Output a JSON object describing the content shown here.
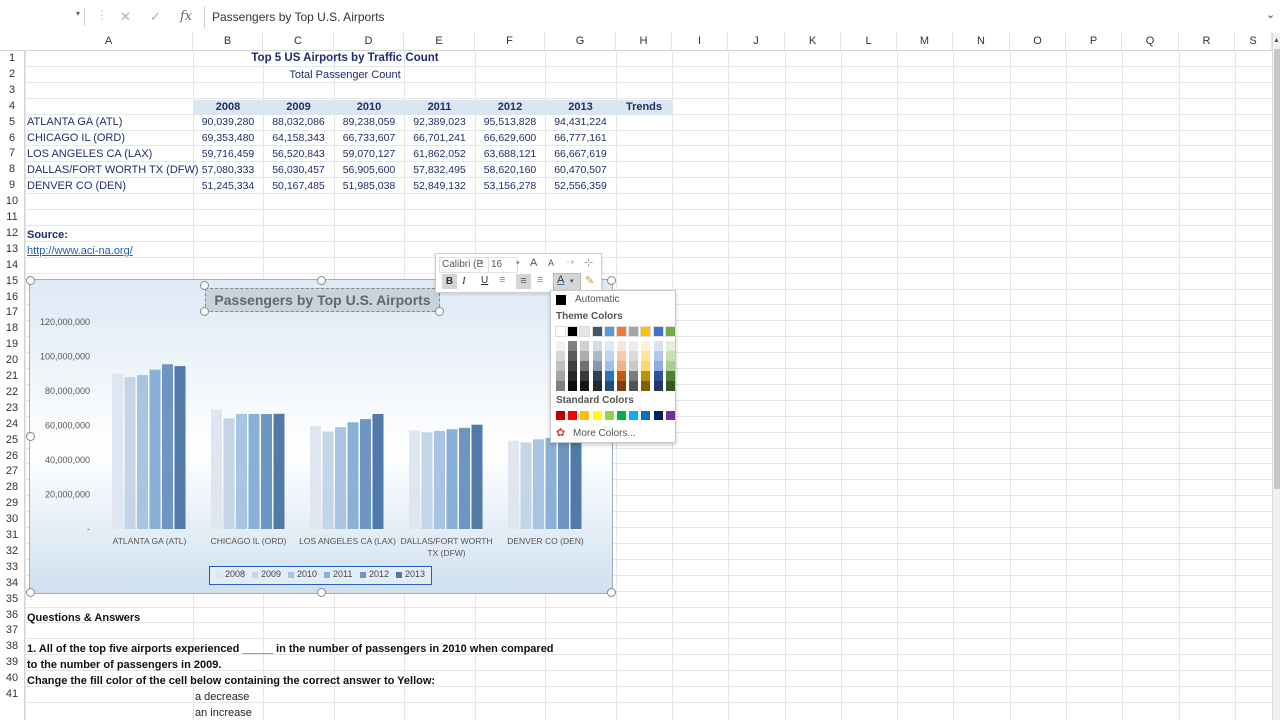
{
  "formula_bar": {
    "name_box": "",
    "cancel": "✕",
    "enter": "✓",
    "fx": "fx",
    "content": "Passengers by Top U.S. Airports"
  },
  "columns": [
    "A",
    "B",
    "C",
    "D",
    "E",
    "F",
    "G",
    "H",
    "I",
    "J",
    "K",
    "L",
    "M",
    "N",
    "O",
    "P",
    "Q",
    "R",
    "S"
  ],
  "rows": [
    "1",
    "2",
    "3",
    "4",
    "5",
    "6",
    "7",
    "8",
    "9",
    "10",
    "11",
    "12",
    "13",
    "14",
    "15",
    "16",
    "17",
    "18",
    "19",
    "20",
    "21",
    "22",
    "23",
    "24",
    "25",
    "26",
    "27",
    "28",
    "29",
    "30",
    "31",
    "32",
    "33",
    "34",
    "35",
    "36",
    "37",
    "38",
    "39",
    "40",
    "41"
  ],
  "sheet": {
    "title": "Top 5 US Airports by Traffic Count",
    "subtitle": "Total Passenger Count",
    "years": [
      "2008",
      "2009",
      "2010",
      "2011",
      "2012",
      "2013"
    ],
    "trends_label": "Trends",
    "airports": [
      {
        "name": "ATLANTA GA (ATL)",
        "values": [
          "90,039,280",
          "88,032,086",
          "89,238,059",
          "92,389,023",
          "95,513,828",
          "94,431,224"
        ]
      },
      {
        "name": "CHICAGO IL (ORD)",
        "values": [
          "69,353,480",
          "64,158,343",
          "66,733,607",
          "66,701,241",
          "66,629,600",
          "66,777,161"
        ]
      },
      {
        "name": "LOS ANGELES CA (LAX)",
        "values": [
          "59,716,459",
          "56,520,843",
          "59,070,127",
          "61,862,052",
          "63,688,121",
          "66,667,619"
        ]
      },
      {
        "name": "DALLAS/FORT WORTH TX (DFW)",
        "values": [
          "57,080,333",
          "56,030,457",
          "56,905,600",
          "57,832,495",
          "58,620,160",
          "60,470,507"
        ]
      },
      {
        "name": "DENVER CO (DEN)",
        "values": [
          "51,245,334",
          "50,167,485",
          "51,985,038",
          "52,849,132",
          "53,156,278",
          "52,556,359"
        ]
      }
    ],
    "source_label": "Source:",
    "source_link": "http://www.aci-na.org/",
    "qa_heading": "Questions & Answers",
    "question1_line1": "1. All of the top five airports experienced _____ in the number of passengers in 2010 when compared",
    "question1_line2": "to the number of passengers in 2009.",
    "instruction": "Change the fill color of the cell below containing the correct answer to Yellow:",
    "answer1": "a decrease",
    "answer2": "an increase"
  },
  "chart_data": {
    "type": "bar",
    "title": "Passengers by Top U.S. Airports",
    "categories": [
      "ATLANTA GA (ATL)",
      "CHICAGO IL (ORD)",
      "LOS ANGELES CA (LAX)",
      "DALLAS/FORT WORTH TX (DFW)",
      "DENVER CO (DEN)"
    ],
    "category_labels": [
      [
        "ATLANTA GA (ATL)"
      ],
      [
        "CHICAGO IL (ORD)"
      ],
      [
        "LOS ANGELES CA (LAX)"
      ],
      [
        "DALLAS/FORT WORTH",
        "TX (DFW)"
      ],
      [
        "DENVER CO (DEN)"
      ]
    ],
    "series": [
      {
        "name": "2008",
        "values": [
          90039280,
          69353480,
          59716459,
          57080333,
          51245334
        ],
        "color": "#dfe6ef"
      },
      {
        "name": "2009",
        "values": [
          88032086,
          64158343,
          56520843,
          56030457,
          50167485
        ],
        "color": "#c4d5e8"
      },
      {
        "name": "2010",
        "values": [
          89238059,
          66733607,
          59070127,
          56905600,
          51985038
        ],
        "color": "#a8c4e2"
      },
      {
        "name": "2011",
        "values": [
          92389023,
          66701241,
          61862052,
          57832495,
          52849132
        ],
        "color": "#8bb0d8"
      },
      {
        "name": "2012",
        "values": [
          95513828,
          66629600,
          63688121,
          58620160,
          53156278
        ],
        "color": "#6f95c2"
      },
      {
        "name": "2013",
        "values": [
          94431224,
          66777161,
          66667619,
          60470507,
          52556359
        ],
        "color": "#527aa8"
      }
    ],
    "y_ticks": [
      "120,000,000",
      "100,000,000",
      "80,000,000",
      "60,000,000",
      "40,000,000",
      "20,000,000",
      "-"
    ],
    "ylim": [
      0,
      120000000
    ],
    "legend_position": "bottom",
    "grid": false
  },
  "mini_toolbar": {
    "font": "Calibri (E",
    "size": "16",
    "grow": "A",
    "shrink": "A",
    "bold": "B",
    "italic": "I",
    "underline": "U",
    "font_color": "A"
  },
  "color_palette": {
    "automatic": "Automatic",
    "theme_label": "Theme Colors",
    "theme_top": [
      "#ffffff",
      "#000000",
      "#e7e6e6",
      "#44546a",
      "#5b9bd5",
      "#ed7d31",
      "#a5a5a5",
      "#ffc000",
      "#4472c4",
      "#70ad47"
    ],
    "theme_shades": [
      [
        "#f2f2f2",
        "#7f7f7f",
        "#d0cece",
        "#d6dce4",
        "#deebf6",
        "#fbe5d5",
        "#ededed",
        "#fff2cc",
        "#dae3f3",
        "#e2efd9"
      ],
      [
        "#d8d8d8",
        "#595959",
        "#aeabab",
        "#adb9ca",
        "#bdd7ee",
        "#f7cbac",
        "#dbdbdb",
        "#fee599",
        "#b4c6e7",
        "#c5e0b3"
      ],
      [
        "#bfbfbf",
        "#3f3f3f",
        "#757070",
        "#8496b0",
        "#9cc3e5",
        "#f4b183",
        "#c9c9c9",
        "#ffd965",
        "#8faadc",
        "#a8d08d"
      ],
      [
        "#a5a5a5",
        "#262626",
        "#3a3838",
        "#323f4f",
        "#2e75b5",
        "#c55a11",
        "#7b7b7b",
        "#bf9000",
        "#2f5496",
        "#538135"
      ],
      [
        "#7f7f7f",
        "#0c0c0c",
        "#171616",
        "#222a35",
        "#1e4e79",
        "#843c0b",
        "#525252",
        "#7f6000",
        "#1f3864",
        "#375623"
      ]
    ],
    "standard_label": "Standard Colors",
    "standard": [
      "#c00000",
      "#ff0000",
      "#ffc000",
      "#ffff00",
      "#92d050",
      "#00b050",
      "#00b0f0",
      "#0070c0",
      "#002060",
      "#7030a0"
    ],
    "more_colors": "More Colors..."
  }
}
